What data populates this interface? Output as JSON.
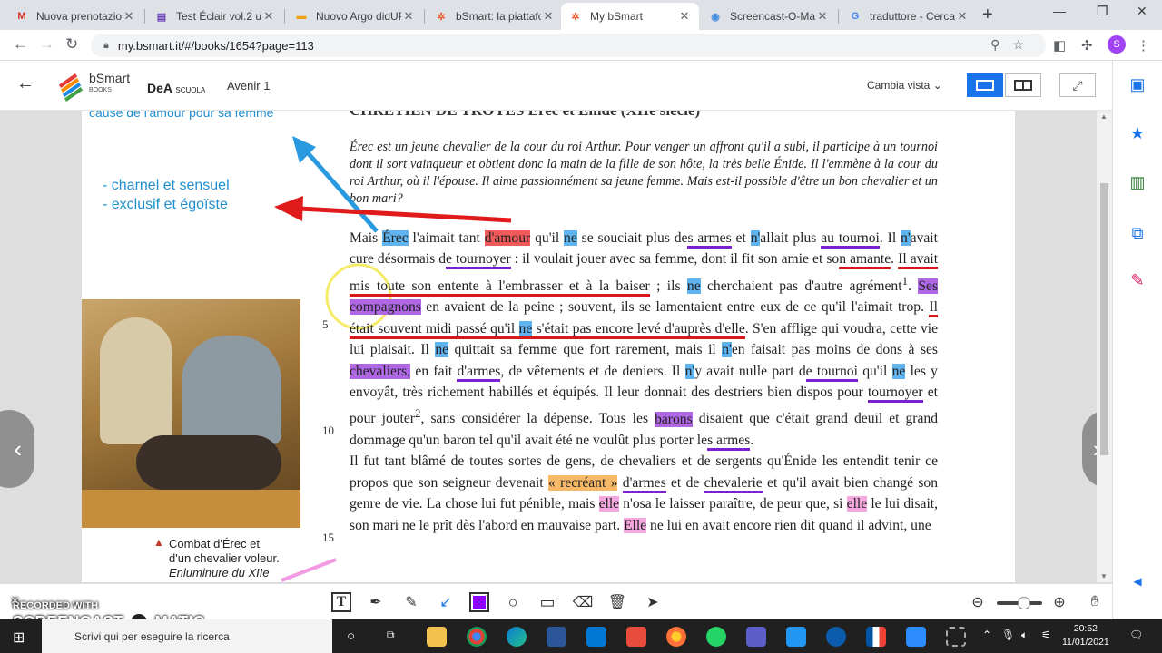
{
  "browser": {
    "tabs": [
      {
        "title": "Nuova prenotazio",
        "favicon": "gmail-icon",
        "glyph": "M",
        "color": "#d93025"
      },
      {
        "title": "Test Éclair vol.2 un",
        "favicon": "forms-icon",
        "glyph": "▤",
        "color": "#673ab7"
      },
      {
        "title": "Nuovo Argo didUP",
        "favicon": "argo-icon",
        "glyph": "▬",
        "color": "#e8a317"
      },
      {
        "title": "bSmart: la piattafo",
        "favicon": "bsmart-icon",
        "glyph": "✲",
        "color": "#e55b2d"
      },
      {
        "title": "My bSmart",
        "favicon": "bsmart-icon",
        "glyph": "✲",
        "color": "#e55b2d"
      },
      {
        "title": "Screencast-O-Mat",
        "favicon": "screencast-icon",
        "glyph": "◉",
        "color": "#4a90e2"
      },
      {
        "title": "traduttore - Cerca",
        "favicon": "google-icon",
        "glyph": "G",
        "color": "#4285f4"
      }
    ],
    "url": "my.bsmart.it/#/books/1654?page=113",
    "profile_initial": "S"
  },
  "app": {
    "logo_text": "bSmart",
    "logo_sub": "BOOKS",
    "publisher": "DeA",
    "publisher_sub": "SCUOLA",
    "book_title": "Avenir 1",
    "view_label": "Cambia vista"
  },
  "page": {
    "header_cut": "CHRÉTIEN DE TROYES Érec et Énide (XIIe siècle)",
    "top_note": "cause de l'amour pour sa femme",
    "blue_notes": [
      "- charnel et sensuel",
      "- exclusif et égoïste"
    ],
    "intro": "Érec est un jeune chevalier de la cour du roi Arthur. Pour venger un affront qu'il a subi, il participe à un tournoi dont il sort vainqueur et obtient donc la main de la fille de son hôte, la très belle Énide. Il l'emmène à la cour du roi Arthur, où il l'épouse. Il aime passionnément sa jeune femme. Mais est-il possible d'être un bon chevalier et un bon mari?",
    "caption": [
      "Combat d'Érec et",
      "d'un chevalier voleur.",
      "Enluminure du XIIe"
    ],
    "line_numbers": [
      "5",
      "10",
      "15"
    ],
    "body": {
      "p1": "Mais ",
      "erec": "Érec",
      "p2": " l'aimait tant ",
      "amour": "d'amour",
      "p3": " qu'il ",
      "ne1": "ne",
      "p4": " se souciait plus de",
      "armes1": "s armes",
      "p5": " et ",
      "n1": "n'",
      "p6": "allait plus ",
      "tournoi1": "au tournoi",
      "p7": ". Il ",
      "n2": "n'",
      "p8": "avait cure désormais d",
      "tournoyer1": "e tournoyer",
      "p9": " : il voulait jouer avec sa femme, dont il fit son amie et so",
      "amante": "n amante",
      "p10": ". ",
      "redsent": "Il avait mis toute son entente à l'embrasser et à la baiser",
      "p11": " ; ils ",
      "ne2": "ne",
      "p12": " cherchaient pas d'autre agrément",
      "sup1": "1",
      "p13": ". ",
      "compagnons": "Ses compagnons",
      "p14": " en avaient de la peine ; souvent, ils se lamentaient entre eux de ce qu'il l'aimait trop. ",
      "redsent2a": "Il était souvent midi passé qu'il ",
      "ne3": "ne",
      "redsent2b": " s'était pas encore levé d'auprès d'elle",
      "p15": ". S'en afflige qui voudra, cette vie lui plaisait. Il ",
      "ne4": "ne",
      "p16": " quittait sa femme que fort rarement, mais il ",
      "n3": "n'",
      "p17": "en faisait pas moins de dons à ses ",
      "chevaliers": "chevaliers,",
      "p18": " en fait ",
      "armes2": "d'armes",
      "p19": ", de vêtements et de deniers. Il ",
      "n4": "n'",
      "p20": "y avait nulle part d",
      "tournoi2": "e tournoi",
      "p21": " qu'il ",
      "ne5": "ne",
      "p22": " les y envoyât, très richement habillés et équipés. Il leur donnait des destriers bien dispos pour ",
      "tournoyer2": "tournoyer",
      "p23": " et pour jouter",
      "sup2": "2",
      "p24": ", sans considérer la dépense. Tous les ",
      "barons": "barons",
      "p25": " disaient que c'était grand deuil et grand dommage qu'un baron tel qu'il avait été ne voulût plus porter le",
      "armes3": "s armes",
      "p26": ".",
      "p27": "Il fut tant blâmé de toutes sortes de gens, de chevaliers et de sergents qu'Énide les entendit tenir ce propos que son seigneur devenait ",
      "recreant": "« recréant »",
      "p28": " ",
      "armes4": "d'armes",
      "p29": " et de ",
      "chevalerie": "chevalerie",
      "p30": " et qu'il avait bien changé son genre de vie. La chose lui fut pénible, mais ",
      "elle1": "elle",
      "p31": " n'osa le laisser paraître, de peur que, si ",
      "elle2": "elle",
      "p32": " le lui disait, son mari ne le prît dès l'abord en mauvaise part. ",
      "elle3": "Elle",
      "p33": " ne lui en avait encore rien dit quand il advint, une"
    }
  },
  "watermark": {
    "line1": "RECORDED WITH",
    "line2": "SCREENCAST",
    "line3": "MATIC"
  },
  "taskbar": {
    "search_placeholder": "Scrivi qui per eseguire la ricerca",
    "time": "20:52",
    "date": "11/01/2021"
  },
  "colors": {
    "accent": "#1a73e8",
    "note_blue": "#1f8fd0",
    "pen_color": "#8e00ff"
  }
}
